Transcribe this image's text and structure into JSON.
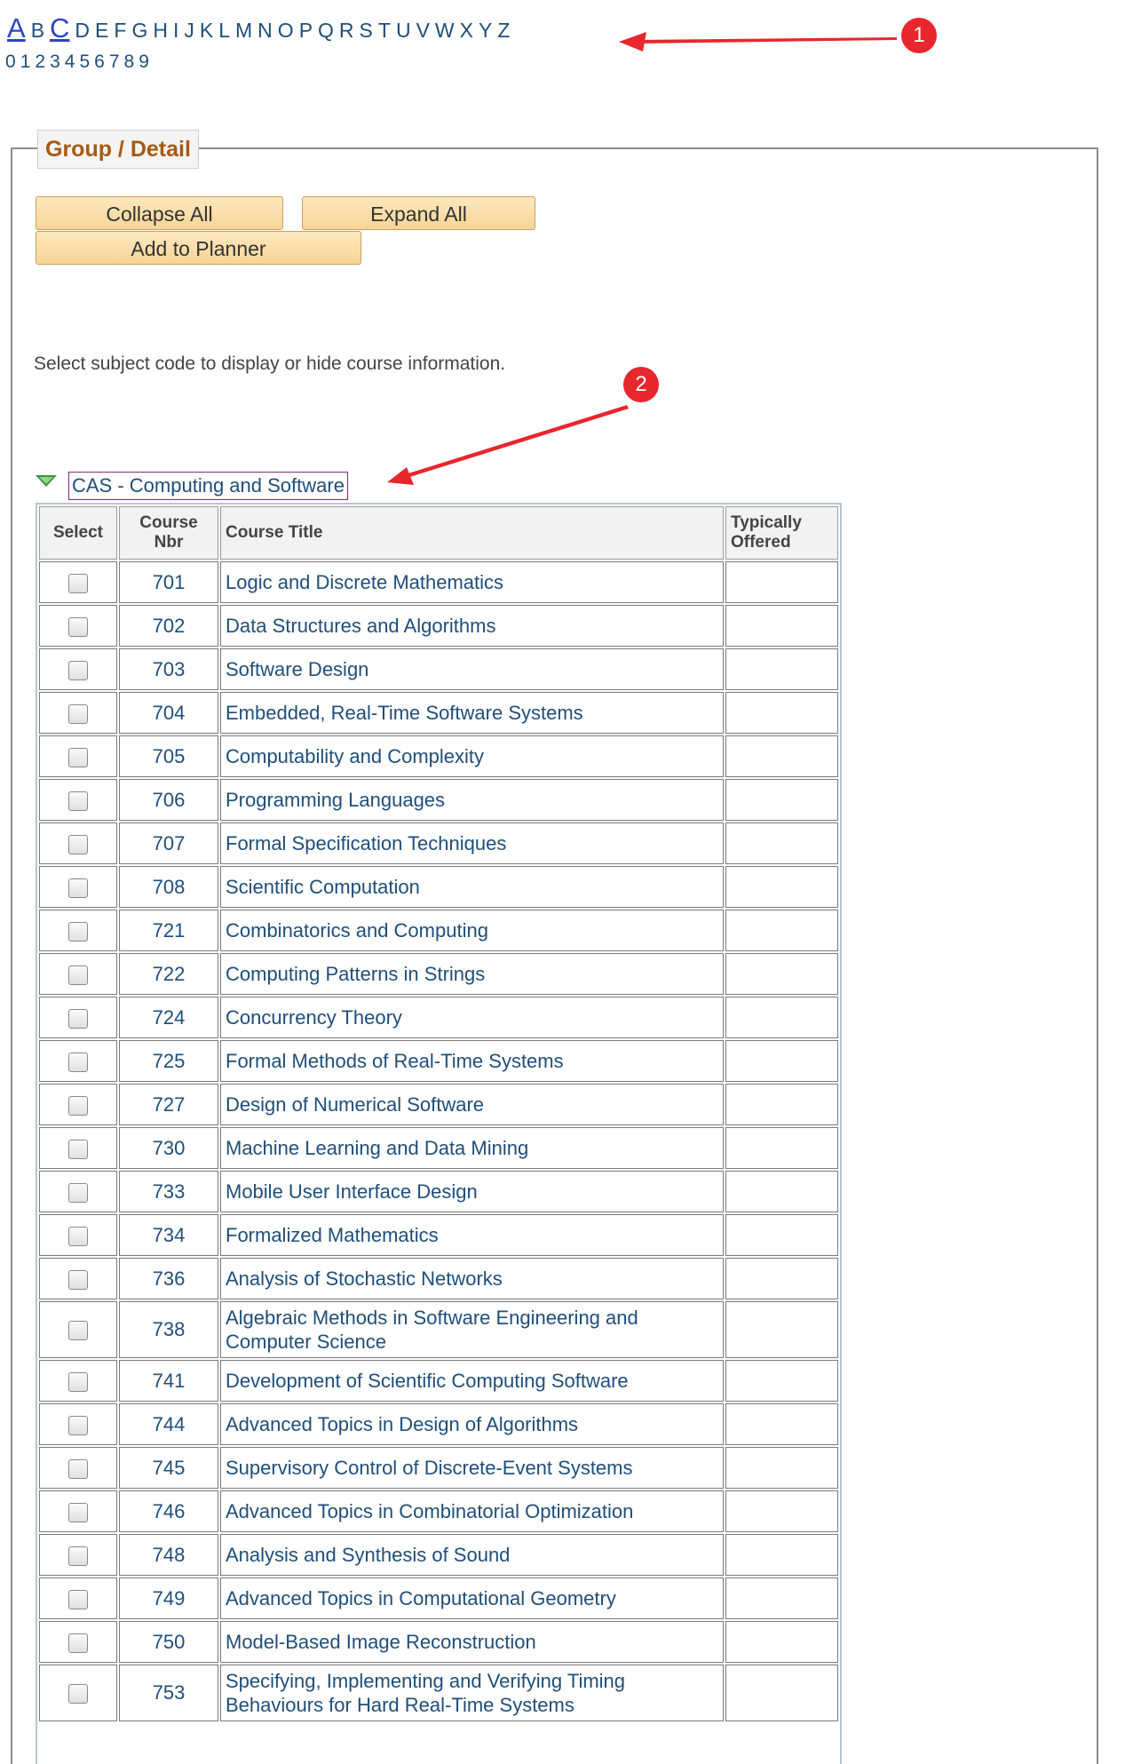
{
  "nav": {
    "letters": [
      "A",
      "B",
      "C",
      "D",
      "E",
      "F",
      "G",
      "H",
      "I",
      "J",
      "K",
      "L",
      "M",
      "N",
      "O",
      "P",
      "Q",
      "R",
      "S",
      "T",
      "U",
      "V",
      "W",
      "X",
      "Y",
      "Z"
    ],
    "digits": [
      "0",
      "1",
      "2",
      "3",
      "4",
      "5",
      "6",
      "7",
      "8",
      "9"
    ]
  },
  "markers": {
    "first": "1",
    "second": "2"
  },
  "group": {
    "legend": "Group / Detail"
  },
  "buttons": {
    "collapse": "Collapse All",
    "expand": "Expand All",
    "planner": "Add to Planner"
  },
  "instruction": "Select subject code to display or hide course information.",
  "subject": "CAS - Computing and Software",
  "table": {
    "headers": {
      "select": "Select",
      "nbr_line1": "Course",
      "nbr_line2": "Nbr",
      "title": "Course Title",
      "typ_line1": "Typically",
      "typ_line2": "Offered"
    },
    "rows": [
      {
        "nbr": "701",
        "title": "Logic and Discrete Mathematics",
        "offered": ""
      },
      {
        "nbr": "702",
        "title": "Data Structures and Algorithms",
        "offered": ""
      },
      {
        "nbr": "703",
        "title": "Software Design",
        "offered": ""
      },
      {
        "nbr": "704",
        "title": "Embedded, Real-Time Software Systems",
        "offered": ""
      },
      {
        "nbr": "705",
        "title": "Computability and Complexity",
        "offered": ""
      },
      {
        "nbr": "706",
        "title": "Programming Languages",
        "offered": ""
      },
      {
        "nbr": "707",
        "title": "Formal Specification Techniques",
        "offered": ""
      },
      {
        "nbr": "708",
        "title": "Scientific Computation",
        "offered": ""
      },
      {
        "nbr": "721",
        "title": "Combinatorics and Computing",
        "offered": ""
      },
      {
        "nbr": "722",
        "title": "Computing Patterns in Strings",
        "offered": ""
      },
      {
        "nbr": "724",
        "title": "Concurrency Theory",
        "offered": ""
      },
      {
        "nbr": "725",
        "title": "Formal Methods of Real-Time Systems",
        "offered": ""
      },
      {
        "nbr": "727",
        "title": "Design of Numerical Software",
        "offered": ""
      },
      {
        "nbr": "730",
        "title": "Machine Learning and Data Mining",
        "offered": ""
      },
      {
        "nbr": "733",
        "title": "Mobile User Interface Design",
        "offered": ""
      },
      {
        "nbr": "734",
        "title": "Formalized Mathematics",
        "offered": ""
      },
      {
        "nbr": "736",
        "title": "Analysis of Stochastic Networks",
        "offered": ""
      },
      {
        "nbr": "738",
        "title": "Algebraic Methods in Software Engineering and",
        "title2": "Computer Science",
        "offered": ""
      },
      {
        "nbr": "741",
        "title": "Development of Scientific Computing Software",
        "offered": ""
      },
      {
        "nbr": "744",
        "title": "Advanced Topics in Design of Algorithms",
        "offered": ""
      },
      {
        "nbr": "745",
        "title": "Supervisory Control of Discrete-Event Systems",
        "offered": ""
      },
      {
        "nbr": "746",
        "title": "Advanced Topics in Combinatorial Optimization",
        "offered": ""
      },
      {
        "nbr": "748",
        "title": "Analysis and Synthesis of Sound",
        "offered": ""
      },
      {
        "nbr": "749",
        "title": "Advanced Topics in Computational Geometry",
        "offered": ""
      },
      {
        "nbr": "750",
        "title": "Model-Based Image Reconstruction",
        "offered": ""
      },
      {
        "nbr": "753",
        "title": "Specifying, Implementing and Verifying Timing",
        "title2": "Behaviours for Hard Real-Time Systems",
        "offered": ""
      }
    ]
  }
}
